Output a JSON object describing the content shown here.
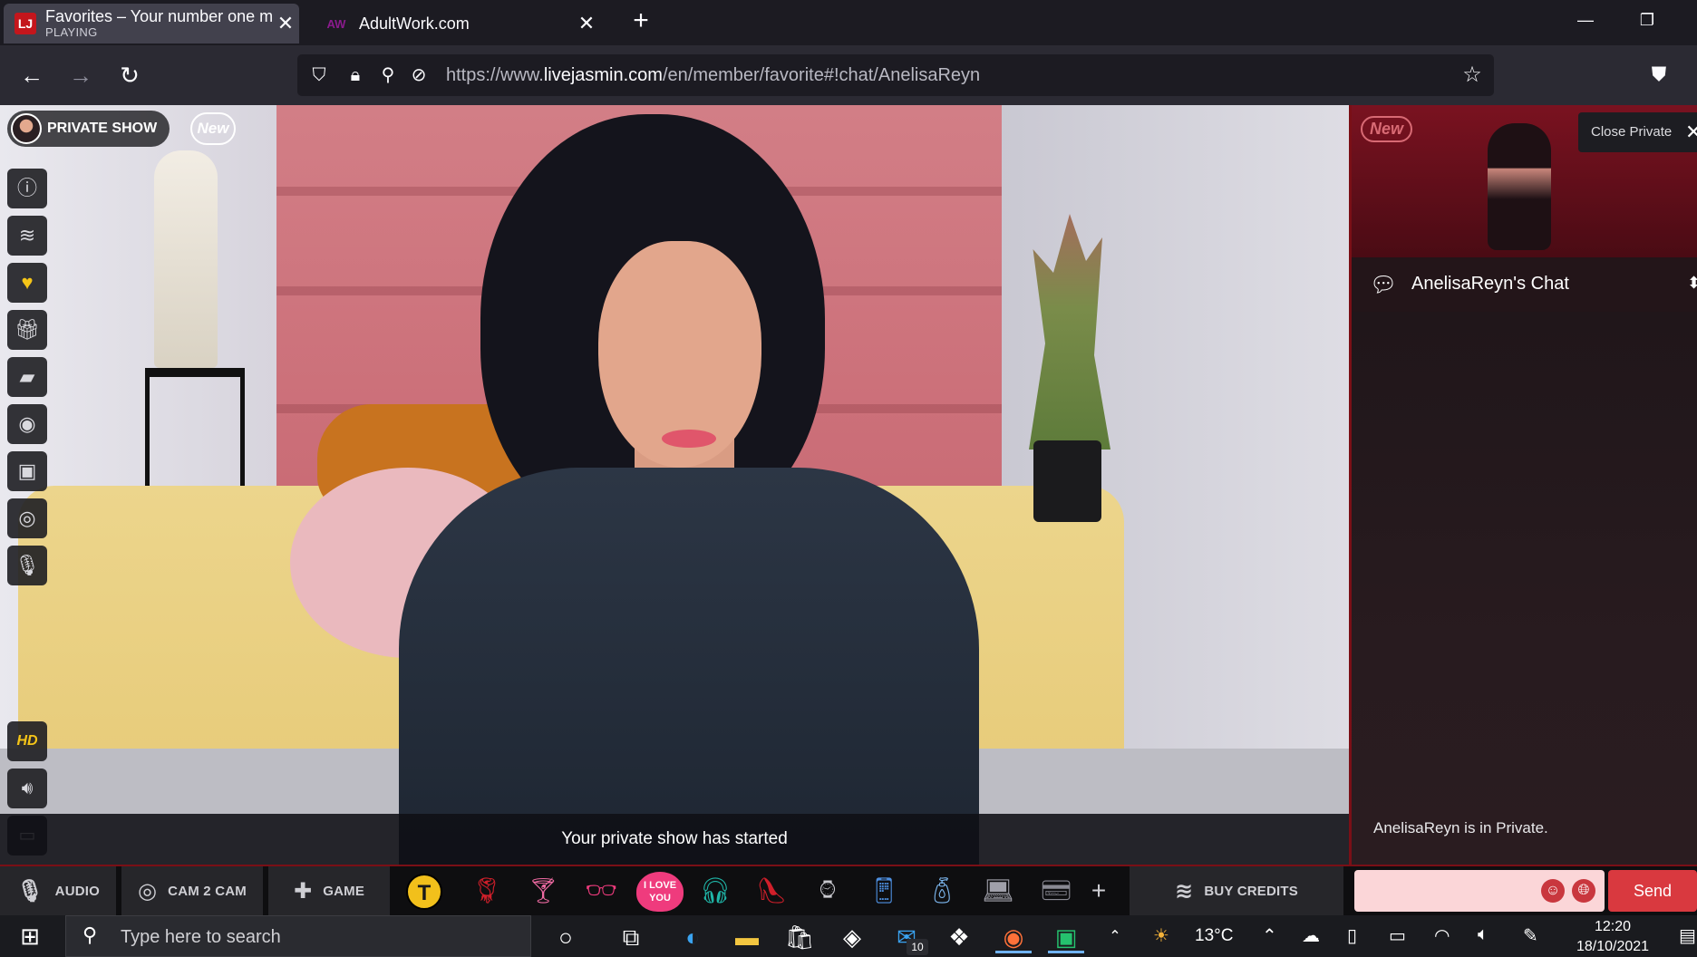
{
  "browser": {
    "tabs": [
      {
        "title": "Favorites – Your number one m",
        "subtitle": "PLAYING",
        "favicon": "LJ"
      },
      {
        "title": "AdultWork.com",
        "favicon": "AW"
      }
    ],
    "new_tab_icon": "+",
    "url_prefix": "https://www.",
    "url_host": "livejasmin.com",
    "url_path": "/en/member/favorite#!chat/AnelisaReyn"
  },
  "player": {
    "private_show_label": "PRIVATE SHOW",
    "new_label": "New",
    "hd_label": "HD",
    "notice": "Your private show has started"
  },
  "panel": {
    "preview_new_label": "New",
    "close_private_label": "Close Private",
    "chat_title": "AnelisaReyn's Chat",
    "chat_message": "AnelisaReyn is in Private."
  },
  "bottombar": {
    "audio_label": "AUDIO",
    "cam2cam_label": "CAM 2 CAM",
    "game_label": "GAME",
    "token_letter": "T",
    "love_text": "I LOVE YOU",
    "buy_credits_label": "BUY CREDITS",
    "send_label": "Send"
  },
  "taskbar": {
    "search_placeholder": "Type here to search",
    "mail_badge": "10",
    "temperature": "13°C",
    "time": "12:20",
    "date": "18/10/2021"
  },
  "colors": {
    "accent": "#d9393f",
    "panel_border": "#7a0f16",
    "favorite_yellow": "#f5c518"
  }
}
